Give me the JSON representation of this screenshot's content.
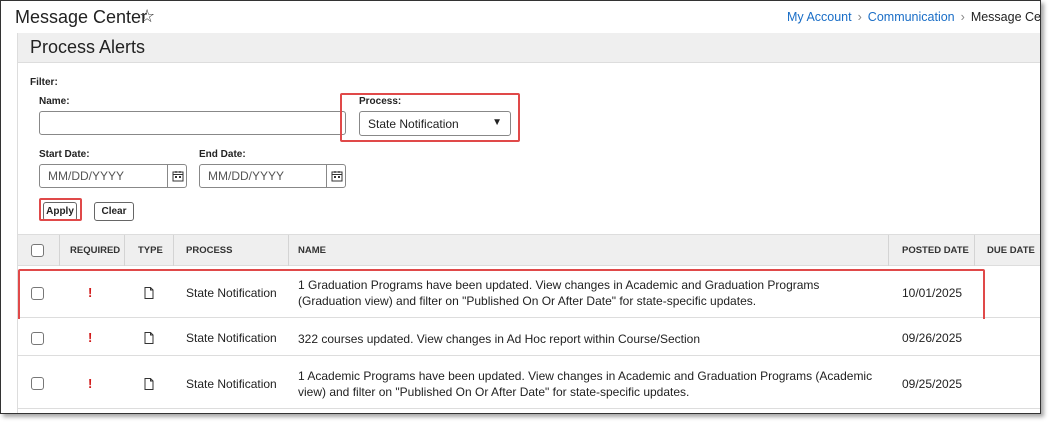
{
  "app": {
    "title": "Message Center",
    "star_icon": "star-outline-icon"
  },
  "breadcrumb": [
    "My Account",
    "Communication",
    "Message Cente"
  ],
  "panel": {
    "title": "Process Alerts"
  },
  "filter": {
    "label": "Filter:",
    "name_label": "Name:",
    "name_value": "",
    "process_label": "Process:",
    "process_selected": "State Notification",
    "start_label": "Start Date:",
    "start_placeholder": "MM/DD/YYYY",
    "end_label": "End Date:",
    "end_placeholder": "MM/DD/YYYY",
    "apply_label": "Apply",
    "clear_label": "Clear"
  },
  "table": {
    "columns": [
      "REQUIRED",
      "TYPE",
      "PROCESS",
      "NAME",
      "POSTED DATE",
      "DUE DATE"
    ],
    "rows": [
      {
        "required": "!",
        "type_icon": "document-icon",
        "process": "State Notification",
        "name": "1 Graduation Programs have been updated. View changes in Academic and Graduation Programs (Graduation view) and filter on \"Published On Or After Date\" for state-specific updates.",
        "posted": "10/01/2025",
        "due": ""
      },
      {
        "required": "!",
        "type_icon": "document-icon",
        "process": "State Notification",
        "name": "322 courses updated. View changes in Ad Hoc report within Course/Section",
        "posted": "09/26/2025",
        "due": ""
      },
      {
        "required": "!",
        "type_icon": "document-icon",
        "process": "State Notification",
        "name": "1 Academic Programs have been updated. View changes in Academic and Graduation Programs (Academic view) and filter on \"Published On Or After Date\" for state-specific updates.",
        "posted": "09/25/2025",
        "due": ""
      }
    ]
  },
  "colors": {
    "link": "#1a6ec7",
    "highlight": "#e04949",
    "required": "#d11a1a"
  }
}
